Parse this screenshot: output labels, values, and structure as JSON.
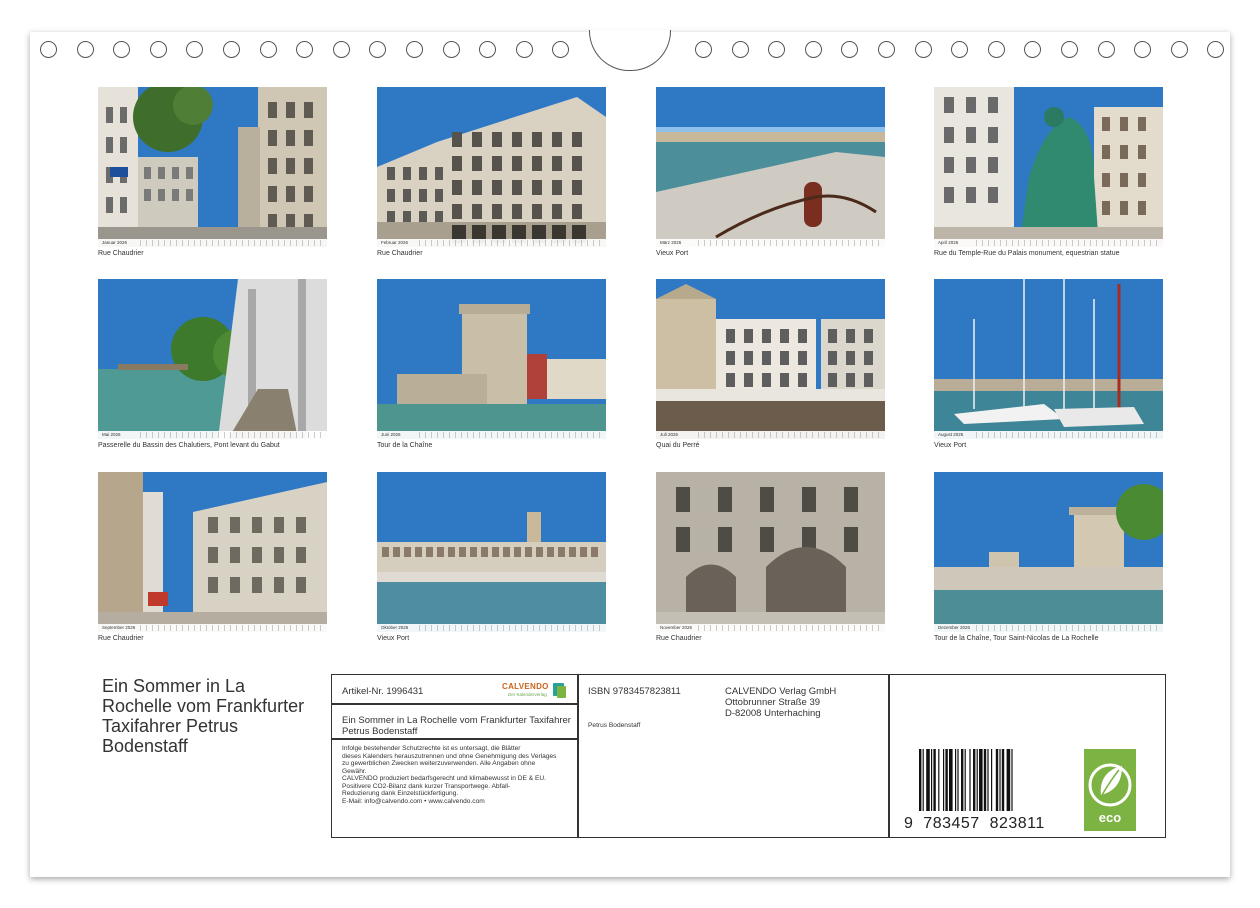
{
  "colors": {
    "accent_green": "#7cb342",
    "logo_orange": "#c8631a",
    "logo_teal": "#2aa198"
  },
  "photos": [
    {
      "month": "Januar 2026",
      "caption": "Rue Chaudrier",
      "scene": "street"
    },
    {
      "month": "Februar 2026",
      "caption": "Rue Chaudrier",
      "scene": "building"
    },
    {
      "month": "März 2026",
      "caption": "Vieux Port",
      "scene": "harbor"
    },
    {
      "month": "April 2026",
      "caption": "Rue du Temple-Rue du Palais  monument, equestrian statue",
      "scene": "statue"
    },
    {
      "month": "Mai 2026",
      "caption": "Passerelle du Bassin des Chalutiers, Pont levant du Gabut",
      "scene": "bridge"
    },
    {
      "month": "Juni 2026",
      "caption": "Tour de la Chaîne",
      "scene": "tower"
    },
    {
      "month": "Juli 2026",
      "caption": "Quai du Perré",
      "scene": "cafe"
    },
    {
      "month": "August 2026",
      "caption": "Vieux Port",
      "scene": "boats"
    },
    {
      "month": "September 2026",
      "caption": "Rue Chaudrier",
      "scene": "street2"
    },
    {
      "month": "Oktober 2026",
      "caption": "Vieux Port",
      "scene": "portview"
    },
    {
      "month": "November 2026",
      "caption": "Rue Chaudrier",
      "scene": "arcade"
    },
    {
      "month": "Dezember 2026",
      "caption": "Tour de la Chaîne, Tour Saint-Nicolas de La Rochelle",
      "scene": "towers"
    }
  ],
  "title": "Ein Sommer in La Rochelle vom Frankfurter Taxifahrer Petrus Bodenstaff",
  "info": {
    "article": "Artikel-Nr. 1996431",
    "logo": "CALVENDO",
    "logo_tagline": "Der Kalenderverlag",
    "title_box": "Ein Sommer in La Rochelle vom Frankfurter Taxifahrer Petrus Bodenstaff",
    "legal_lines": [
      "Infolge bestehender Schutzrechte ist es untersagt, die Blätter",
      "dieses Kalenders herauszutrennen und ohne Genehmigung des Verlages",
      "zu gewerblichen Zwecken weiterzuverwenden. Alle Angaben ohne",
      "Gewähr.",
      "CALVENDO produziert bedarfsgerecht und klimabewusst in DE & EU.",
      "Positivere CO2-Bilanz dank kurzer Transportwege. Abfall-",
      "Reduzierung dank Einzelstückfertigung.",
      "E-Mail: info@calvendo.com • www.calvendo.com"
    ],
    "isbn": "ISBN 9783457823811",
    "author": "Petrus Bodenstaff",
    "publisher_lines": [
      "CALVENDO Verlag GmbH",
      "Ottobrunner Straße 39",
      "D-82008 Unterhaching"
    ],
    "barcode_digits": "9  783457  823811",
    "eco_label": "eco"
  }
}
